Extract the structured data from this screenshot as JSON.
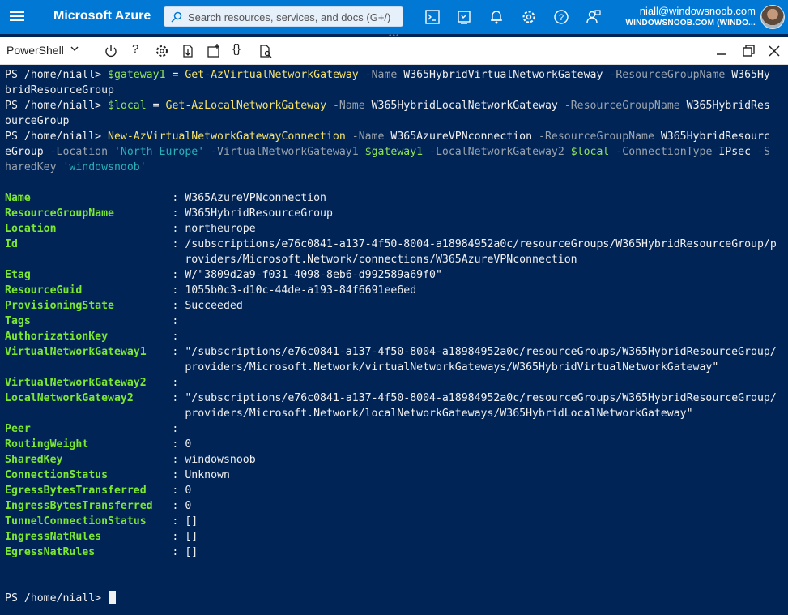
{
  "topbar": {
    "brand": "Microsoft Azure",
    "search_placeholder": "Search resources, services, and docs (G+/)",
    "icons": [
      "cloud-shell-icon",
      "directory-filter-icon",
      "notifications-icon",
      "settings-icon",
      "help-icon",
      "feedback-icon"
    ],
    "user_email": "niall@windowsnoob.com",
    "user_tenant": "WINDOWSNOOB.COM (WINDO..."
  },
  "toolbar": {
    "shell": "PowerShell",
    "help": "?",
    "braces": "{}",
    "icons": [
      "power-icon",
      "help-icon",
      "settings-icon",
      "upload-download-icon",
      "new-session-icon",
      "editor-icon",
      "web-preview-icon",
      "minimize-icon",
      "maximize-icon",
      "close-icon"
    ]
  },
  "terminal": {
    "prompt": "PS /home/niall>",
    "commands": [
      {
        "l1_var": "$gateway1",
        "l1_eq": " = ",
        "l1_fn": "Get-AzVirtualNetworkGateway",
        "l1_p1": " -Name ",
        "l1_v1": "W365HybridVirtualNetworkGateway",
        "l1_p2": " -ResourceGroupName ",
        "l1_v2a": "W365Hy",
        "l2": "bridResourceGroup"
      },
      {
        "l1_var": "$local",
        "l1_eq": " = ",
        "l1_fn": "Get-AzLocalNetworkGateway",
        "l1_p1": " -Name ",
        "l1_v1": "W365HybridLocalNetworkGateway",
        "l1_p2": " -ResourceGroupName ",
        "l1_v2a": "W365HybridRes",
        "l2": "ourceGroup"
      }
    ],
    "cmd3": {
      "fn": "New-AzVirtualNetworkGatewayConnection",
      "p_name": " -Name ",
      "v_name": "W365AzureVPNconnection",
      "p_rg": " -ResourceGroupName ",
      "v_rg_a": "W365HybridResourc",
      "v_rg_b": "eGroup",
      "p_loc": " -Location ",
      "v_loc": "'North Europe'",
      "p_gw1": " -VirtualNetworkGateway1 ",
      "v_gw1": "$gateway1",
      "p_gw2": " -LocalNetworkGateway2 ",
      "v_gw2": "$local",
      "p_ct": " -ConnectionType ",
      "v_ct": "IPsec",
      "p_sk_a": " -S",
      "p_sk_b": "haredKey ",
      "v_sk": "'windowsnoob'"
    },
    "sep": ": ",
    "output": [
      {
        "key": "Name",
        "value": "W365AzureVPNconnection",
        "cont": ""
      },
      {
        "key": "ResourceGroupName",
        "value": "W365HybridResourceGroup",
        "cont": ""
      },
      {
        "key": "Location",
        "value": "northeurope",
        "cont": ""
      },
      {
        "key": "Id",
        "value": "/subscriptions/e76c0841-a137-4f50-8004-a18984952a0c/resourceGroups/W365HybridResourceGroup/p",
        "cont": "roviders/Microsoft.Network/connections/W365AzureVPNconnection"
      },
      {
        "key": "Etag",
        "value": "W/\"3809d2a9-f031-4098-8eb6-d992589a69f0\"",
        "cont": ""
      },
      {
        "key": "ResourceGuid",
        "value": "1055b0c3-d10c-44de-a193-84f6691ee6ed",
        "cont": ""
      },
      {
        "key": "ProvisioningState",
        "value": "Succeeded",
        "cont": ""
      },
      {
        "key": "Tags",
        "value": "",
        "cont": ""
      },
      {
        "key": "AuthorizationKey",
        "value": "",
        "cont": ""
      },
      {
        "key": "VirtualNetworkGateway1",
        "value": "\"/subscriptions/e76c0841-a137-4f50-8004-a18984952a0c/resourceGroups/W365HybridResourceGroup/",
        "cont": "providers/Microsoft.Network/virtualNetworkGateways/W365HybridVirtualNetworkGateway\""
      },
      {
        "key": "VirtualNetworkGateway2",
        "value": "",
        "cont": ""
      },
      {
        "key": "LocalNetworkGateway2",
        "value": "\"/subscriptions/e76c0841-a137-4f50-8004-a18984952a0c/resourceGroups/W365HybridResourceGroup/",
        "cont": "providers/Microsoft.Network/localNetworkGateways/W365HybridLocalNetworkGateway\""
      },
      {
        "key": "Peer",
        "value": "",
        "cont": ""
      },
      {
        "key": "RoutingWeight",
        "value": "0",
        "cont": ""
      },
      {
        "key": "SharedKey",
        "value": "windowsnoob",
        "cont": ""
      },
      {
        "key": "ConnectionStatus",
        "value": "Unknown",
        "cont": ""
      },
      {
        "key": "EgressBytesTransferred",
        "value": "0",
        "cont": ""
      },
      {
        "key": "IngressBytesTransferred",
        "value": "0",
        "cont": ""
      },
      {
        "key": "TunnelConnectionStatus",
        "value": "[]",
        "cont": ""
      },
      {
        "key": "IngressNatRules",
        "value": "[]",
        "cont": ""
      },
      {
        "key": "EgressNatRules",
        "value": "[]",
        "cont": ""
      }
    ]
  }
}
